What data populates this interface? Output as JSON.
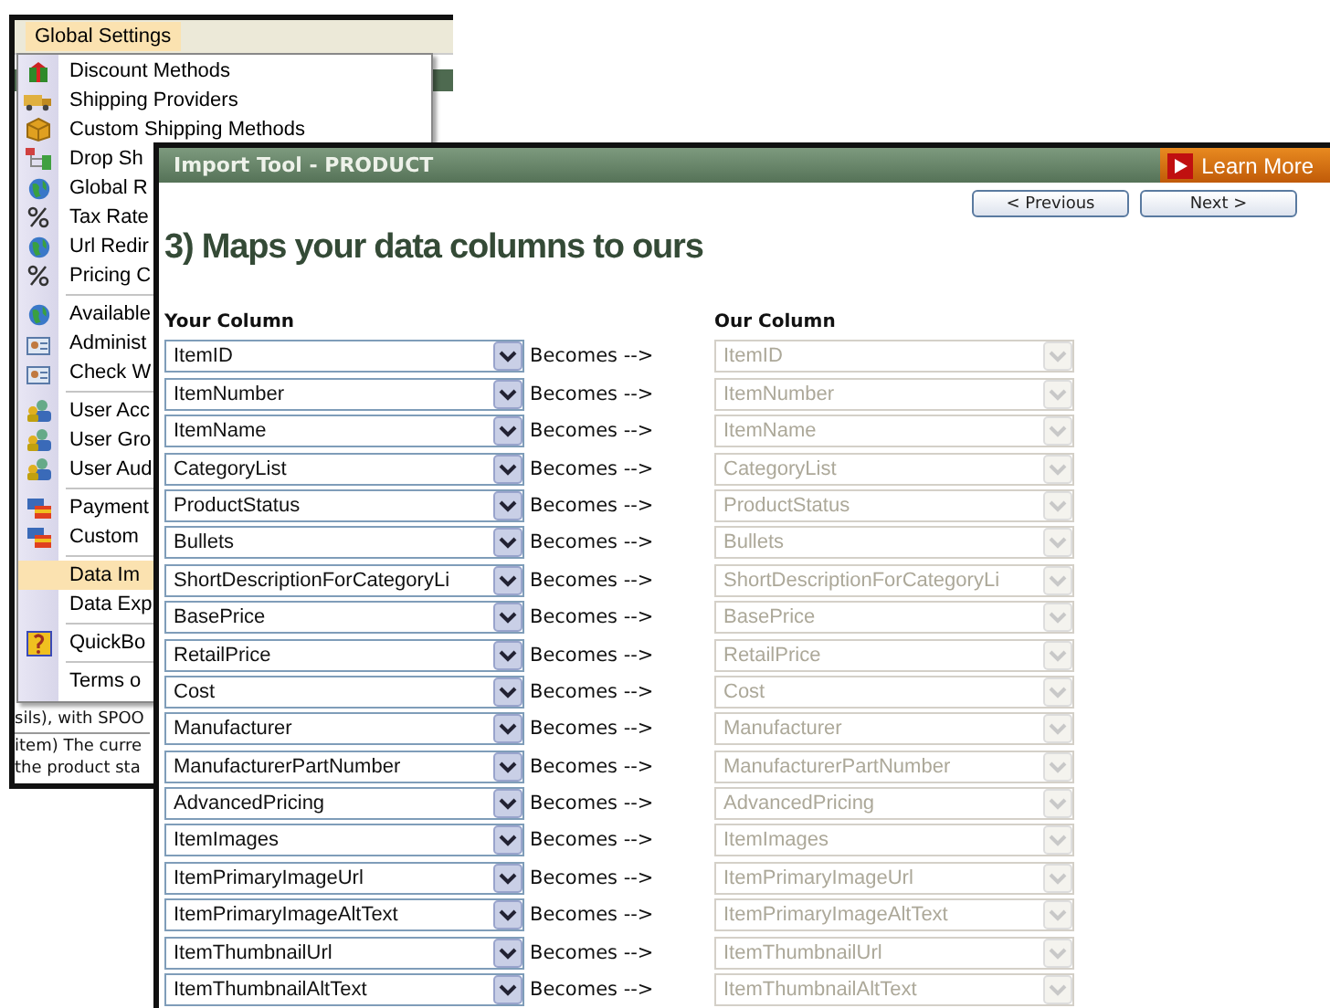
{
  "background_window": {
    "menu_bar": [
      {
        "label": "Global Settings",
        "selected": true
      }
    ],
    "menu": [
      {
        "kind": "item",
        "label": "Discount Methods",
        "selected": false
      },
      {
        "kind": "item",
        "label": "Shipping Providers",
        "selected": false
      },
      {
        "kind": "item",
        "label": "Custom Shipping Methods",
        "selected": false
      },
      {
        "kind": "item",
        "label": "Drop Sh",
        "selected": false
      },
      {
        "kind": "item",
        "label": "Global R",
        "selected": false
      },
      {
        "kind": "item",
        "label": "Tax Rate",
        "selected": false
      },
      {
        "kind": "item",
        "label": "Url Redir",
        "selected": false
      },
      {
        "kind": "item",
        "label": "Pricing C",
        "selected": false
      },
      {
        "kind": "separator"
      },
      {
        "kind": "item",
        "label": "Available",
        "selected": false
      },
      {
        "kind": "item",
        "label": "Administ",
        "selected": false
      },
      {
        "kind": "item",
        "label": "Check W",
        "selected": false
      },
      {
        "kind": "separator"
      },
      {
        "kind": "item",
        "label": "User Acc",
        "selected": false
      },
      {
        "kind": "item",
        "label": "User Gro",
        "selected": false
      },
      {
        "kind": "item",
        "label": "User Aud",
        "selected": false
      },
      {
        "kind": "separator"
      },
      {
        "kind": "item",
        "label": "Payment",
        "selected": false
      },
      {
        "kind": "item",
        "label": "Custom",
        "selected": false
      },
      {
        "kind": "separator"
      },
      {
        "kind": "item",
        "label": "Data Im",
        "selected": true
      },
      {
        "kind": "item",
        "label": "Data Exp",
        "selected": false
      },
      {
        "kind": "separator"
      },
      {
        "kind": "item",
        "label": "QuickBo",
        "selected": false
      },
      {
        "kind": "separator"
      },
      {
        "kind": "item",
        "label": "Terms o",
        "selected": false
      }
    ],
    "page_text": [
      "sils), with SPOO",
      "item) The curre",
      "the product sta"
    ]
  },
  "import_window": {
    "title": "Import Tool - PRODUCT",
    "learn_more": "Learn More",
    "buttons": [
      "< Previous",
      "Next >"
    ],
    "heading": "3) Maps your data columns to ours",
    "columns": [
      "Your Column",
      "Our Column"
    ],
    "mappings": [
      {
        "source": "ItemID",
        "source_disabled": false,
        "connector": "Becomes -->",
        "target": "ItemID",
        "target_disabled": true
      },
      {
        "source": "ItemNumber",
        "source_disabled": false,
        "connector": "Becomes -->",
        "target": "ItemNumber",
        "target_disabled": true
      },
      {
        "source": "ItemName",
        "source_disabled": false,
        "connector": "Becomes -->",
        "target": "ItemName",
        "target_disabled": true
      },
      {
        "source": "CategoryList",
        "source_disabled": false,
        "connector": "Becomes -->",
        "target": "CategoryList",
        "target_disabled": true
      },
      {
        "source": "ProductStatus",
        "source_disabled": false,
        "connector": "Becomes -->",
        "target": "ProductStatus",
        "target_disabled": true
      },
      {
        "source": "Bullets",
        "source_disabled": false,
        "connector": "Becomes -->",
        "target": "Bullets",
        "target_disabled": true
      },
      {
        "source": "ShortDescriptionForCategoryLi",
        "source_disabled": false,
        "connector": "Becomes -->",
        "target": "ShortDescriptionForCategoryLi",
        "target_disabled": true
      },
      {
        "source": "BasePrice",
        "source_disabled": false,
        "connector": "Becomes -->",
        "target": "BasePrice",
        "target_disabled": true
      },
      {
        "source": "RetailPrice",
        "source_disabled": false,
        "connector": "Becomes -->",
        "target": "RetailPrice",
        "target_disabled": true
      },
      {
        "source": "Cost",
        "source_disabled": false,
        "connector": "Becomes -->",
        "target": "Cost",
        "target_disabled": true
      },
      {
        "source": "Manufacturer",
        "source_disabled": false,
        "connector": "Becomes -->",
        "target": "Manufacturer",
        "target_disabled": true
      },
      {
        "source": "ManufacturerPartNumber",
        "source_disabled": false,
        "connector": "Becomes -->",
        "target": "ManufacturerPartNumber",
        "target_disabled": true
      },
      {
        "source": "AdvancedPricing",
        "source_disabled": false,
        "connector": "Becomes -->",
        "target": "AdvancedPricing",
        "target_disabled": true
      },
      {
        "source": "ItemImages",
        "source_disabled": false,
        "connector": "Becomes -->",
        "target": "ItemImages",
        "target_disabled": true
      },
      {
        "source": "ItemPrimaryImageUrl",
        "source_disabled": false,
        "connector": "Becomes -->",
        "target": "ItemPrimaryImageUrl",
        "target_disabled": true
      },
      {
        "source": "ItemPrimaryImageAltText",
        "source_disabled": false,
        "connector": "Becomes -->",
        "target": "ItemPrimaryImageAltText",
        "target_disabled": true
      },
      {
        "source": "ItemThumbnailUrl",
        "source_disabled": false,
        "connector": "Becomes -->",
        "target": "ItemThumbnailUrl",
        "target_disabled": true
      },
      {
        "source": "ItemThumbnailAltText",
        "source_disabled": false,
        "connector": "Becomes -->",
        "target": "ItemThumbnailAltText",
        "target_disabled": true
      }
    ]
  }
}
